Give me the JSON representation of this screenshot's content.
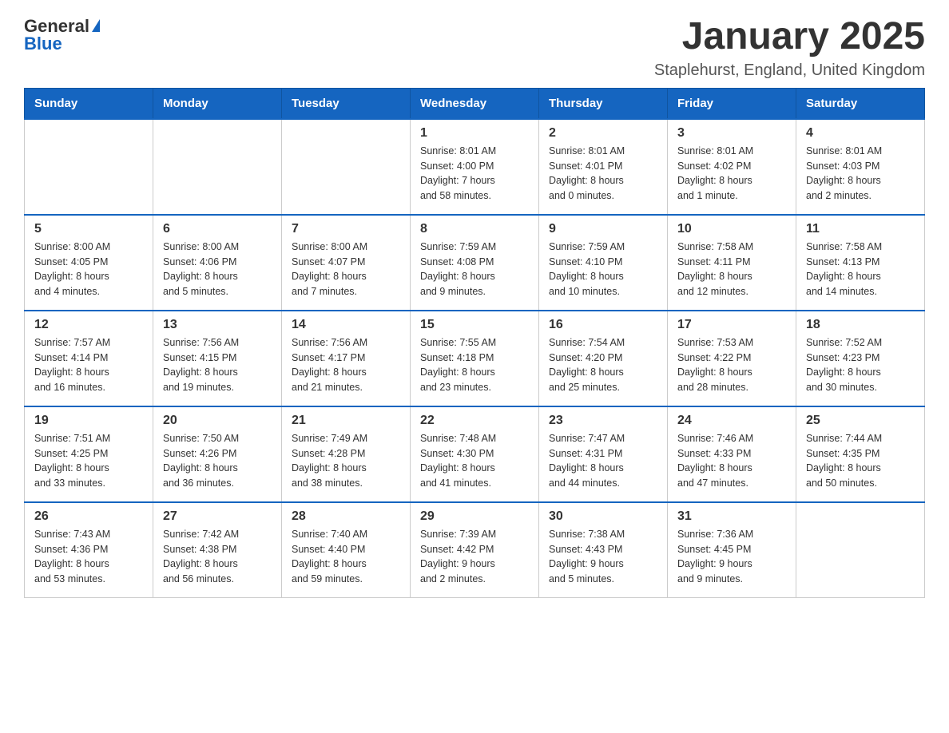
{
  "header": {
    "logo_general": "General",
    "logo_blue": "Blue",
    "title": "January 2025",
    "location": "Staplehurst, England, United Kingdom"
  },
  "columns": [
    "Sunday",
    "Monday",
    "Tuesday",
    "Wednesday",
    "Thursday",
    "Friday",
    "Saturday"
  ],
  "weeks": [
    [
      {
        "day": "",
        "info": ""
      },
      {
        "day": "",
        "info": ""
      },
      {
        "day": "",
        "info": ""
      },
      {
        "day": "1",
        "info": "Sunrise: 8:01 AM\nSunset: 4:00 PM\nDaylight: 7 hours\nand 58 minutes."
      },
      {
        "day": "2",
        "info": "Sunrise: 8:01 AM\nSunset: 4:01 PM\nDaylight: 8 hours\nand 0 minutes."
      },
      {
        "day": "3",
        "info": "Sunrise: 8:01 AM\nSunset: 4:02 PM\nDaylight: 8 hours\nand 1 minute."
      },
      {
        "day": "4",
        "info": "Sunrise: 8:01 AM\nSunset: 4:03 PM\nDaylight: 8 hours\nand 2 minutes."
      }
    ],
    [
      {
        "day": "5",
        "info": "Sunrise: 8:00 AM\nSunset: 4:05 PM\nDaylight: 8 hours\nand 4 minutes."
      },
      {
        "day": "6",
        "info": "Sunrise: 8:00 AM\nSunset: 4:06 PM\nDaylight: 8 hours\nand 5 minutes."
      },
      {
        "day": "7",
        "info": "Sunrise: 8:00 AM\nSunset: 4:07 PM\nDaylight: 8 hours\nand 7 minutes."
      },
      {
        "day": "8",
        "info": "Sunrise: 7:59 AM\nSunset: 4:08 PM\nDaylight: 8 hours\nand 9 minutes."
      },
      {
        "day": "9",
        "info": "Sunrise: 7:59 AM\nSunset: 4:10 PM\nDaylight: 8 hours\nand 10 minutes."
      },
      {
        "day": "10",
        "info": "Sunrise: 7:58 AM\nSunset: 4:11 PM\nDaylight: 8 hours\nand 12 minutes."
      },
      {
        "day": "11",
        "info": "Sunrise: 7:58 AM\nSunset: 4:13 PM\nDaylight: 8 hours\nand 14 minutes."
      }
    ],
    [
      {
        "day": "12",
        "info": "Sunrise: 7:57 AM\nSunset: 4:14 PM\nDaylight: 8 hours\nand 16 minutes."
      },
      {
        "day": "13",
        "info": "Sunrise: 7:56 AM\nSunset: 4:15 PM\nDaylight: 8 hours\nand 19 minutes."
      },
      {
        "day": "14",
        "info": "Sunrise: 7:56 AM\nSunset: 4:17 PM\nDaylight: 8 hours\nand 21 minutes."
      },
      {
        "day": "15",
        "info": "Sunrise: 7:55 AM\nSunset: 4:18 PM\nDaylight: 8 hours\nand 23 minutes."
      },
      {
        "day": "16",
        "info": "Sunrise: 7:54 AM\nSunset: 4:20 PM\nDaylight: 8 hours\nand 25 minutes."
      },
      {
        "day": "17",
        "info": "Sunrise: 7:53 AM\nSunset: 4:22 PM\nDaylight: 8 hours\nand 28 minutes."
      },
      {
        "day": "18",
        "info": "Sunrise: 7:52 AM\nSunset: 4:23 PM\nDaylight: 8 hours\nand 30 minutes."
      }
    ],
    [
      {
        "day": "19",
        "info": "Sunrise: 7:51 AM\nSunset: 4:25 PM\nDaylight: 8 hours\nand 33 minutes."
      },
      {
        "day": "20",
        "info": "Sunrise: 7:50 AM\nSunset: 4:26 PM\nDaylight: 8 hours\nand 36 minutes."
      },
      {
        "day": "21",
        "info": "Sunrise: 7:49 AM\nSunset: 4:28 PM\nDaylight: 8 hours\nand 38 minutes."
      },
      {
        "day": "22",
        "info": "Sunrise: 7:48 AM\nSunset: 4:30 PM\nDaylight: 8 hours\nand 41 minutes."
      },
      {
        "day": "23",
        "info": "Sunrise: 7:47 AM\nSunset: 4:31 PM\nDaylight: 8 hours\nand 44 minutes."
      },
      {
        "day": "24",
        "info": "Sunrise: 7:46 AM\nSunset: 4:33 PM\nDaylight: 8 hours\nand 47 minutes."
      },
      {
        "day": "25",
        "info": "Sunrise: 7:44 AM\nSunset: 4:35 PM\nDaylight: 8 hours\nand 50 minutes."
      }
    ],
    [
      {
        "day": "26",
        "info": "Sunrise: 7:43 AM\nSunset: 4:36 PM\nDaylight: 8 hours\nand 53 minutes."
      },
      {
        "day": "27",
        "info": "Sunrise: 7:42 AM\nSunset: 4:38 PM\nDaylight: 8 hours\nand 56 minutes."
      },
      {
        "day": "28",
        "info": "Sunrise: 7:40 AM\nSunset: 4:40 PM\nDaylight: 8 hours\nand 59 minutes."
      },
      {
        "day": "29",
        "info": "Sunrise: 7:39 AM\nSunset: 4:42 PM\nDaylight: 9 hours\nand 2 minutes."
      },
      {
        "day": "30",
        "info": "Sunrise: 7:38 AM\nSunset: 4:43 PM\nDaylight: 9 hours\nand 5 minutes."
      },
      {
        "day": "31",
        "info": "Sunrise: 7:36 AM\nSunset: 4:45 PM\nDaylight: 9 hours\nand 9 minutes."
      },
      {
        "day": "",
        "info": ""
      }
    ]
  ]
}
